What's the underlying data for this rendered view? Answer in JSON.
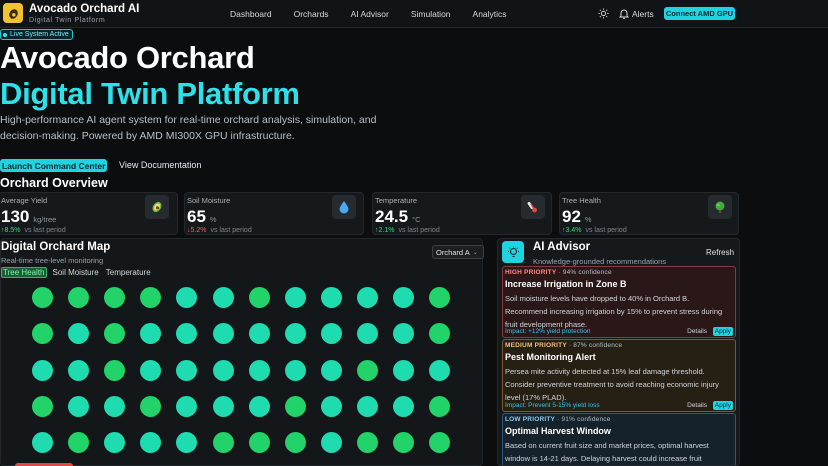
{
  "app": {
    "title": "Avocado Orchard AI",
    "subtitle": "Digital Twin Platform"
  },
  "nav": {
    "links": [
      "Dashboard",
      "Orchards",
      "AI Advisor",
      "Simulation",
      "Analytics"
    ],
    "alerts_label": "Alerts",
    "connect_label": "Connect AMD GPU"
  },
  "hero": {
    "badge": "Live System Active",
    "title_line1": "Avocado Orchard",
    "title_line2": "Digital Twin Platform",
    "description": "High-performance AI agent system for real-time orchard analysis, simulation, and decision-making. Powered by AMD MI300X GPU infrastructure.",
    "primary_cta": "Launch Command Center",
    "secondary_cta": "View Documentation"
  },
  "overview": {
    "title": "Orchard Overview",
    "stats": [
      {
        "label": "Average Yield",
        "value": "130",
        "unit": "kg/tree",
        "delta": "↑8.5%",
        "trend": "up",
        "vs": "vs last period",
        "icon": "avocado-icon"
      },
      {
        "label": "Soil Moisture",
        "value": "65",
        "unit": "%",
        "delta": "↓5.2%",
        "trend": "down",
        "vs": "vs last period",
        "icon": "water-drop-icon"
      },
      {
        "label": "Temperature",
        "value": "24.5",
        "unit": "°C",
        "delta": "↑2.1%",
        "trend": "up",
        "vs": "vs last period",
        "icon": "thermometer-icon"
      },
      {
        "label": "Tree Health",
        "value": "92",
        "unit": "%",
        "delta": "↑3.4%",
        "trend": "up",
        "vs": "vs last period",
        "icon": "tree-icon"
      }
    ]
  },
  "map": {
    "title": "Digital Orchard Map",
    "subtitle": "Real-time tree-level monitoring",
    "selected_orchard": "Orchard A",
    "tabs": [
      "Tree Health",
      "Soil Moisture",
      "Temperature"
    ],
    "active_tab": 0,
    "tree_colors": {
      "healthy": "#22d36a",
      "teal": "#1fdcb0"
    },
    "tree_rows": [
      [
        "healthy",
        "healthy",
        "healthy",
        "healthy",
        "teal",
        "teal",
        "healthy",
        "teal",
        "teal",
        "teal",
        "teal",
        "healthy"
      ],
      [
        "healthy",
        "teal",
        "healthy",
        "teal",
        "teal",
        "teal",
        "teal",
        "teal",
        "teal",
        "teal",
        "teal",
        "healthy"
      ],
      [
        "teal",
        "teal",
        "healthy",
        "teal",
        "teal",
        "teal",
        "teal",
        "teal",
        "teal",
        "healthy",
        "teal",
        "teal"
      ],
      [
        "healthy",
        "teal",
        "teal",
        "healthy",
        "teal",
        "teal",
        "teal",
        "healthy",
        "teal",
        "teal",
        "teal",
        "healthy"
      ],
      [
        "teal",
        "healthy",
        "teal",
        "teal",
        "teal",
        "healthy",
        "healthy",
        "healthy",
        "teal",
        "healthy",
        "healthy",
        "healthy"
      ]
    ]
  },
  "advisor": {
    "title": "AI Advisor",
    "subtitle": "Knowledge-grounded recommendations",
    "refresh_label": "Refresh",
    "recommendations": [
      {
        "priority": "HIGH PRIORITY",
        "confidence": "94% confidence",
        "title": "Increase Irrigation in Zone B",
        "body": "Soil moisture levels have dropped to 40% in Orchard B. Recommend increasing irrigation by 15% to prevent stress during fruit development phase.",
        "impact": "Impact: +12% yield protection",
        "details_label": "Details",
        "apply_label": "Apply",
        "border": "#8a3a3a",
        "bg": "#2a1818",
        "prio_color": "#ff8a80"
      },
      {
        "priority": "MEDIUM PRIORITY",
        "confidence": "87% confidence",
        "title": "Pest Monitoring Alert",
        "body": "Persea mite activity detected at 15% leaf damage threshold. Consider preventive treatment to avoid reaching economic injury level (17% PLAD).",
        "impact": "Impact: Prevent 5-15% yield loss",
        "details_label": "Details",
        "apply_label": "Apply",
        "border": "#7a5a2a",
        "bg": "#261f14",
        "prio_color": "#f2c07a"
      },
      {
        "priority": "LOW PRIORITY",
        "confidence": "91% confidence",
        "title": "Optimal Harvest Window",
        "body": "Based on current fruit size and market prices, optimal harvest window is 14-21 days. Delaying harvest could increase fruit",
        "impact": "",
        "details_label": "",
        "apply_label": "",
        "border": "#2a5a7a",
        "bg": "#15222b",
        "prio_color": "#8ecbf0"
      }
    ]
  }
}
